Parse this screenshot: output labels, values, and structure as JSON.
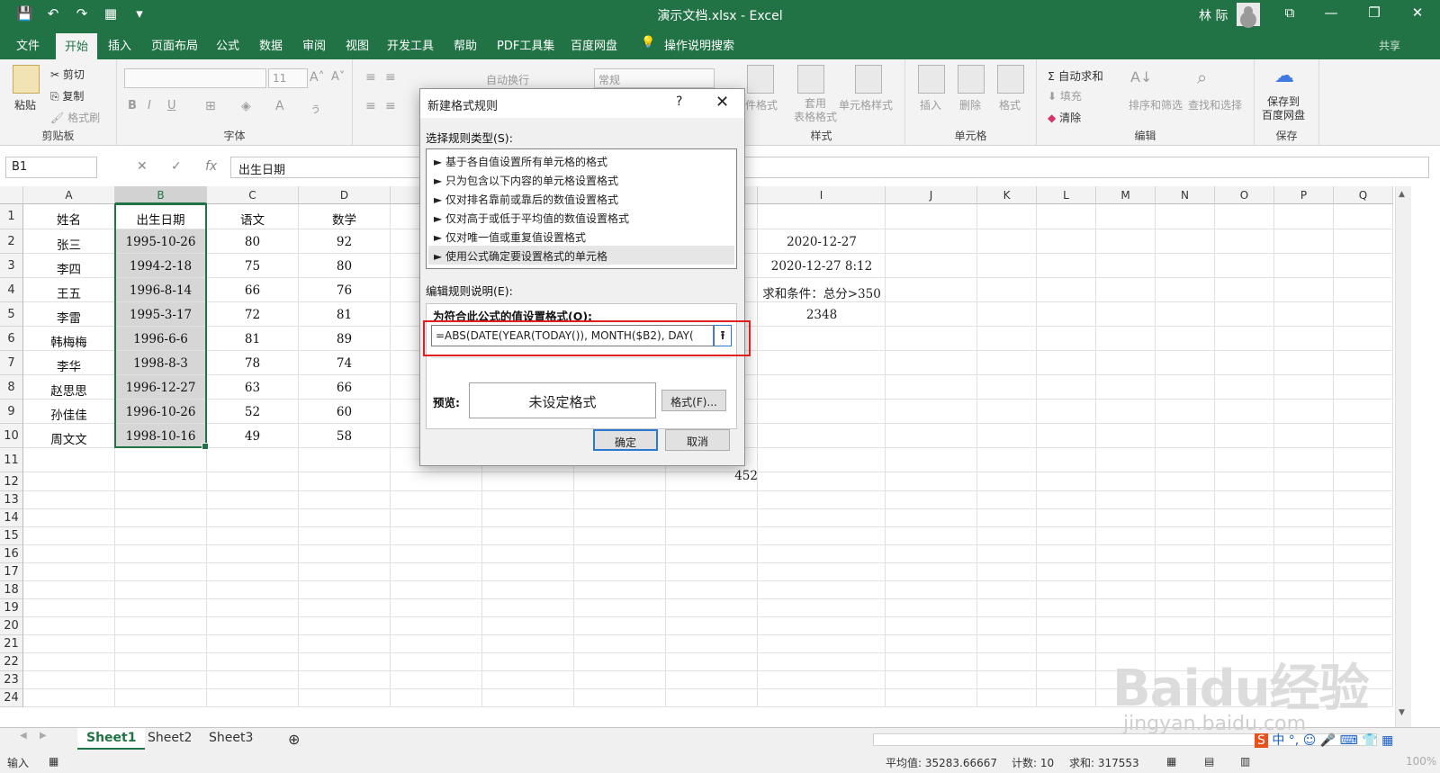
{
  "titlebar": {
    "title": "演示文档.xlsx - Excel",
    "user": "林 际",
    "qat": [
      "💾",
      "↶",
      "↷",
      "▦",
      "▾"
    ],
    "window_buttons": [
      "⧉",
      "—",
      "❐",
      "✕"
    ]
  },
  "tabs": [
    "文件",
    "开始",
    "插入",
    "页面布局",
    "公式",
    "数据",
    "审阅",
    "视图",
    "开发工具",
    "帮助",
    "PDF工具集",
    "百度网盘"
  ],
  "active_tab": "开始",
  "tell_me": "操作说明搜索",
  "share": "共享",
  "ribbon": {
    "clipboard": {
      "paste": "粘贴",
      "cut": "剪切",
      "copy": "复制",
      "format_painter": "格式刷",
      "label": "剪贴板"
    },
    "font": {
      "size": "11",
      "label": "字体",
      "bold": "B",
      "italic": "I",
      "underline": "U"
    },
    "alignment": {
      "wrap": "自动换行"
    },
    "number": {
      "format": "常规"
    },
    "styles": {
      "cond_format": "件格式",
      "table_style": "套用\n表格格式",
      "cell_style": "单元格样式",
      "label": "样式"
    },
    "cells": {
      "insert": "插入",
      "delete": "删除",
      "format": "格式",
      "label": "单元格"
    },
    "editing": {
      "autosum": "Σ 自动求和",
      "fill": "填充",
      "clear": "清除",
      "sort": "排序和筛选",
      "find": "查找和选择",
      "label": "编辑"
    },
    "save": {
      "btn": "保存到\n百度网盘",
      "label": "保存"
    }
  },
  "formula_bar": {
    "name_box": "B1",
    "fx": "fx",
    "content": "出生日期"
  },
  "columns": [
    "A",
    "B",
    "C",
    "D",
    "",
    "",
    "",
    "",
    "I",
    "J",
    "K",
    "L",
    "M",
    "N",
    "O",
    "P",
    "Q"
  ],
  "rows": [
    [
      "姓名",
      "出生日期",
      "语文",
      "数学"
    ],
    [
      "张三",
      "1995-10-26",
      "80",
      "92"
    ],
    [
      "李四",
      "1994-2-18",
      "75",
      "80"
    ],
    [
      "王五",
      "1996-8-14",
      "66",
      "76"
    ],
    [
      "李雷",
      "1995-3-17",
      "72",
      "81"
    ],
    [
      "韩梅梅",
      "1996-6-6",
      "81",
      "89"
    ],
    [
      "李华",
      "1998-8-3",
      "78",
      "74"
    ],
    [
      "赵思思",
      "1996-12-27",
      "63",
      "66"
    ],
    [
      "孙佳佳",
      "1996-10-26",
      "52",
      "60"
    ],
    [
      "周文文",
      "1998-10-16",
      "49",
      "58"
    ]
  ],
  "row_numbers": [
    "1",
    "2",
    "3",
    "4",
    "5",
    "6",
    "7",
    "8",
    "9",
    "10",
    "11",
    "12",
    "13",
    "14",
    "15",
    "16",
    "17",
    "18",
    "19",
    "20",
    "21",
    "22",
    "23",
    "24"
  ],
  "col_i": [
    "",
    "2020-12-27",
    "2020-12-27 8:12",
    "求和条件：总分>350",
    "2348"
  ],
  "cell_h11": "452",
  "dialog": {
    "title": "新建格式规则",
    "help": "?",
    "close": "✕",
    "select_label": "选择规则类型(S):",
    "rule_types": [
      "► 基于各自值设置所有单元格的格式",
      "► 只为包含以下内容的单元格设置格式",
      "► 仅对排名靠前或靠后的数值设置格式",
      "► 仅对高于或低于平均值的数值设置格式",
      "► 仅对唯一值或重复值设置格式",
      "► 使用公式确定要设置格式的单元格"
    ],
    "selected_rule": 5,
    "edit_label": "编辑规则说明(E):",
    "formula_label": "为符合此公式的值设置格式(O):",
    "formula": "=ABS(DATE(YEAR(TODAY()), MONTH($B2), DAY(",
    "ref_button": "⭱",
    "preview_label": "预览:",
    "preview_text": "未设定格式",
    "format_button": "格式(F)...",
    "ok": "确定",
    "cancel": "取消"
  },
  "sheets": [
    "Sheet1",
    "Sheet2",
    "Sheet3"
  ],
  "active_sheet": "Sheet1",
  "status": {
    "mode": "输入",
    "average": "平均值: 35283.66667",
    "count": "计数: 10",
    "sum": "求和: 317553",
    "zoom": "100%"
  },
  "watermark": {
    "logo": "Baidu经验",
    "url": "jingyan.baidu.com"
  },
  "colors": {
    "excel_green": "#217346",
    "selection_red": "#e02020",
    "dialog_blue": "#2b79d0"
  }
}
